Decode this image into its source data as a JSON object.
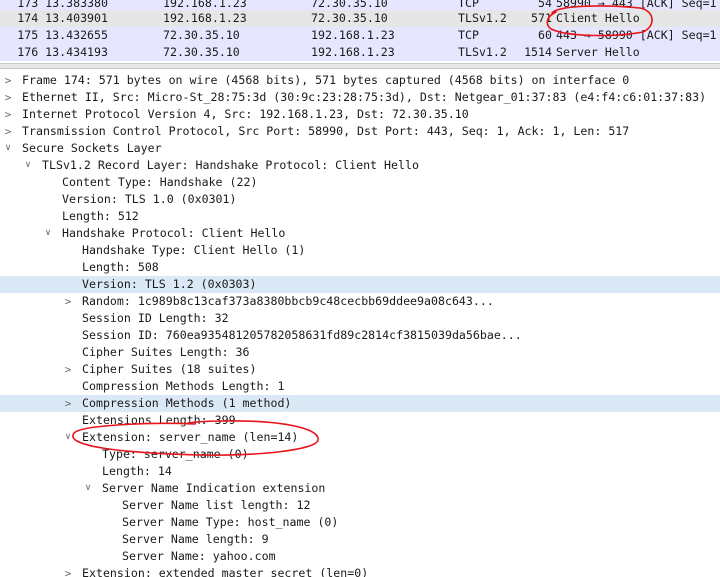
{
  "packets": [
    {
      "no": "173 13.383380",
      "src": "192.168.1.23",
      "dst": "72.30.35.10",
      "proto": "TCP",
      "len": "54",
      "info": "58990 → 443 [ACK] Seq=1",
      "bg": "#e7e6ff"
    },
    {
      "no": "174 13.403901",
      "src": "192.168.1.23",
      "dst": "72.30.35.10",
      "proto": "TLSv1.2",
      "len": "571",
      "info": "Client Hello",
      "bg": "#e6e6e6"
    },
    {
      "no": "175 13.432655",
      "src": "72.30.35.10",
      "dst": "192.168.1.23",
      "proto": "TCP",
      "len": "60",
      "info": "443 → 58990 [ACK] Seq=1",
      "bg": "#e7e6ff"
    },
    {
      "no": "176 13.434193",
      "src": "72.30.35.10",
      "dst": "192.168.1.23",
      "proto": "TLSv1.2",
      "len": "1514",
      "info": "Server Hello",
      "bg": "#e7e6ff"
    }
  ],
  "details": [
    {
      "text": "Frame 174: 571 bytes on wire (4568 bits), 571 bytes captured (4568 bits) on interface 0",
      "expander": "collapsed",
      "highlight": false
    },
    {
      "text": "Ethernet II, Src: Micro-St_28:75:3d (30:9c:23:28:75:3d), Dst: Netgear_01:37:83 (e4:f4:c6:01:37:83)",
      "expander": "collapsed",
      "highlight": false
    },
    {
      "text": "Internet Protocol Version 4, Src: 192.168.1.23, Dst: 72.30.35.10",
      "expander": "collapsed",
      "highlight": false
    },
    {
      "text": "Transmission Control Protocol, Src Port: 58990, Dst Port: 443, Seq: 1, Ack: 1, Len: 517",
      "expander": "collapsed",
      "highlight": false
    },
    {
      "text": "Secure Sockets Layer",
      "expander": "expanded",
      "highlight": false
    },
    {
      "text": "TLSv1.2 Record Layer: Handshake Protocol: Client Hello",
      "expander": "expanded",
      "highlight": false
    },
    {
      "text": "Content Type: Handshake (22)",
      "expander": "none",
      "highlight": false
    },
    {
      "text": "Version: TLS 1.0 (0x0301)",
      "expander": "none",
      "highlight": false
    },
    {
      "text": "Length: 512",
      "expander": "none",
      "highlight": false
    },
    {
      "text": "Handshake Protocol: Client Hello",
      "expander": "expanded",
      "highlight": false
    },
    {
      "text": "Handshake Type: Client Hello (1)",
      "expander": "none",
      "highlight": false
    },
    {
      "text": "Length: 508",
      "expander": "none",
      "highlight": false
    },
    {
      "text": "Version: TLS 1.2 (0x0303)",
      "expander": "none",
      "highlight": true
    },
    {
      "text": "Random: 1c989b8c13caf373a8380bbcb9c48cecbb69ddee9a08c643...",
      "expander": "collapsed",
      "highlight": false
    },
    {
      "text": "Session ID Length: 32",
      "expander": "none",
      "highlight": false
    },
    {
      "text": "Session ID: 760ea935481205782058631fd89c2814cf3815039da56bae...",
      "expander": "none",
      "highlight": false
    },
    {
      "text": "Cipher Suites Length: 36",
      "expander": "none",
      "highlight": false
    },
    {
      "text": "Cipher Suites (18 suites)",
      "expander": "collapsed",
      "highlight": false
    },
    {
      "text": "Compression Methods Length: 1",
      "expander": "none",
      "highlight": false
    },
    {
      "text": "Compression Methods (1 method)",
      "expander": "collapsed",
      "highlight": true
    },
    {
      "text": "Extensions Length: 399",
      "expander": "none",
      "highlight": false
    },
    {
      "text": "Extension: server_name (len=14)",
      "expander": "expanded",
      "highlight": false
    },
    {
      "text": "Type: server_name (0)",
      "expander": "none",
      "highlight": false
    },
    {
      "text": "Length: 14",
      "expander": "none",
      "highlight": false
    },
    {
      "text": "Server Name Indication extension",
      "expander": "expanded",
      "highlight": false
    },
    {
      "text": "Server Name list length: 12",
      "expander": "none",
      "highlight": false
    },
    {
      "text": "Server Name Type: host_name (0)",
      "expander": "none",
      "highlight": false
    },
    {
      "text": "Server Name length: 9",
      "expander": "none",
      "highlight": false
    },
    {
      "text": "Server Name: yahoo.com",
      "expander": "none",
      "highlight": false
    },
    {
      "text": "Extension: extended_master_secret (len=0)",
      "expander": "collapsed",
      "highlight": false
    }
  ],
  "annotation_color": "#e8141b",
  "icons": {
    "expanded": "chevron-down-icon",
    "collapsed": "chevron-right-icon"
  }
}
